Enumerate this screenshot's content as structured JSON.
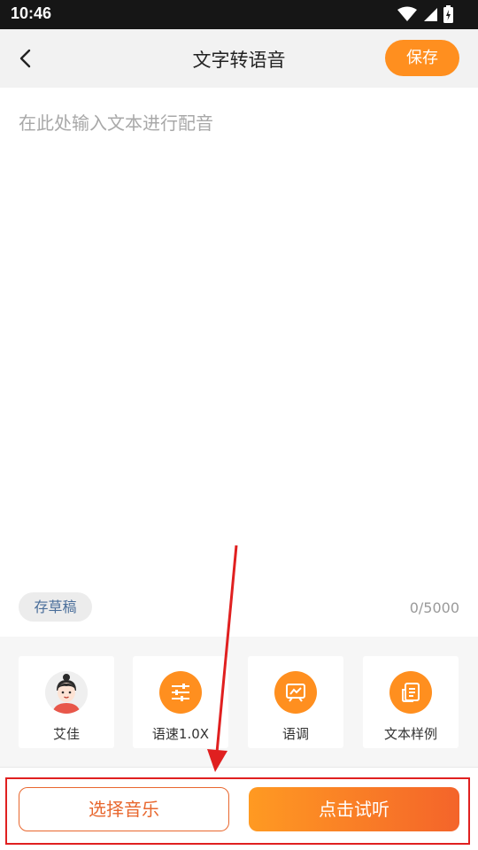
{
  "status_bar": {
    "time": "10:46",
    "icons": [
      "wifi-icon",
      "signal-icon",
      "battery-charging-icon"
    ]
  },
  "header": {
    "back_icon": "chevron-left-icon",
    "title": "文字转语音",
    "save_label": "保存"
  },
  "editor": {
    "placeholder": "在此处输入文本进行配音",
    "draft_label": "存草稿",
    "char_count": "0/5000"
  },
  "options": [
    {
      "label": "艾佳",
      "icon": "avatar-icon"
    },
    {
      "label": "语速1.0X",
      "icon": "sliders-icon"
    },
    {
      "label": "语调",
      "icon": "trend-chart-icon"
    },
    {
      "label": "文本样例",
      "icon": "document-icon"
    }
  ],
  "bottom": {
    "music_label": "选择音乐",
    "listen_label": "点击试听"
  },
  "colors": {
    "accent": "#ff8f1f",
    "accent_gradient_end": "#f4642a",
    "annotation_red": "#e02020"
  }
}
